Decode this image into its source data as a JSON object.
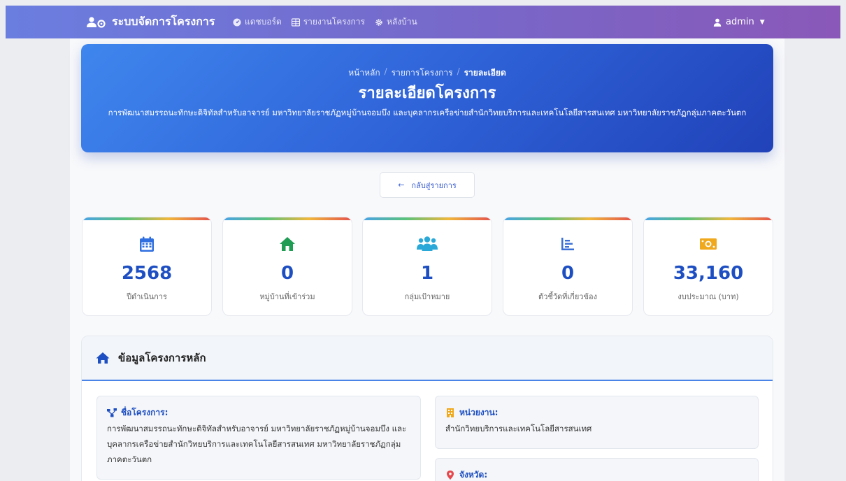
{
  "navbar": {
    "brand": "ระบบจัดการโครงการ",
    "items": [
      {
        "label": "แดชบอร์ด",
        "icon": "dashboard-icon"
      },
      {
        "label": "รายงานโครงการ",
        "icon": "table-icon"
      },
      {
        "label": "หลังบ้าน",
        "icon": "gear-icon"
      }
    ],
    "user": "admin"
  },
  "hero": {
    "breadcrumb": [
      "หน้าหลัก",
      "รายการโครงการ",
      "รายละเอียด"
    ],
    "title": "รายละเอียดโครงการ",
    "subtitle": "การพัฒนาสมรรถนะทักษะดิจิทัลสำหรับอาจารย์ มหาวิทยาลัยราชภัฏหมู่บ้านจอมบึง และบุคลากรเครือข่ายสำนักวิทยบริการและเทคโนโลยีสารสนเทศ มหาวิทยาลัยราชภัฏกลุ่มภาคตะวันตก"
  },
  "back_button": "กลับสู่รายการ",
  "stats": [
    {
      "value": "2568",
      "label": "ปีดำเนินการ",
      "icon": "calendar-icon",
      "color": "#2f6fe0"
    },
    {
      "value": "0",
      "label": "หมู่บ้านที่เข้าร่วม",
      "icon": "home-icon",
      "color": "#1f9d55"
    },
    {
      "value": "1",
      "label": "กลุ่มเป้าหมาย",
      "icon": "users-icon",
      "color": "#2aa9d8"
    },
    {
      "value": "0",
      "label": "ตัวชี้วัดที่เกี่ยวข้อง",
      "icon": "chart-list-icon",
      "color": "#3a6fd8"
    },
    {
      "value": "33,160",
      "label": "งบประมาณ (บาท)",
      "icon": "money-icon",
      "color": "#f0a81c"
    }
  ],
  "panel": {
    "title": "ข้อมูลโครงการหลัก",
    "project_name_label": "ชื่อโครงการ:",
    "project_name_value": "การพัฒนาสมรรถนะทักษะดิจิทัลสำหรับอาจารย์ มหาวิทยาลัยราชภัฏหมู่บ้านจอมบึง และบุคลากรเครือข่ายสำนักวิทยบริการและเทคโนโลยีสารสนเทศ มหาวิทยาลัยราชภัฏกลุ่มภาคตะวันตก",
    "agency_label": "หน่วยงาน:",
    "agency_value": "สำนักวิทยบริการและเทคโนโลยีสารสนเทศ",
    "province_label": "จังหวัด:"
  }
}
